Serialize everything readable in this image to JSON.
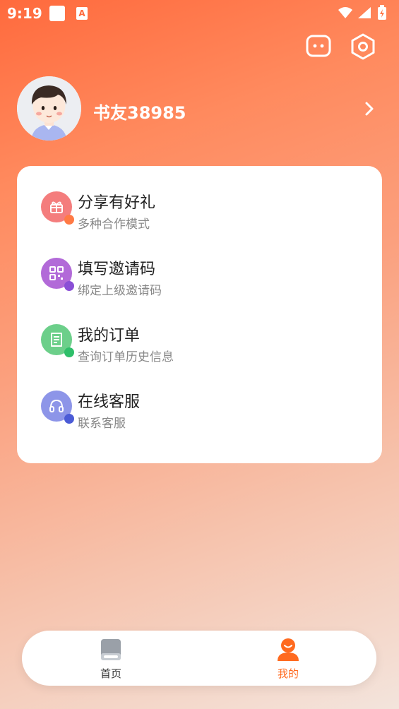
{
  "status_bar": {
    "time": "9:19",
    "a_badge": "A"
  },
  "profile": {
    "username": "书友38985"
  },
  "menu": [
    {
      "title": "分享有好礼",
      "subtitle": "多种合作模式",
      "icon": "gift-icon",
      "color": "#f47d7d",
      "accent": "#ff7a45"
    },
    {
      "title": "填写邀请码",
      "subtitle": "绑定上级邀请码",
      "icon": "qr-code-icon",
      "color": "#b26ad8",
      "accent": "#8a4fd6"
    },
    {
      "title": "我的订单",
      "subtitle": "查询订单历史信息",
      "icon": "receipt-icon",
      "color": "#6ccf8a",
      "accent": "#2fbf6a"
    },
    {
      "title": "在线客服",
      "subtitle": "联系客服",
      "icon": "headset-icon",
      "color": "#8d95e8",
      "accent": "#4b5bd6"
    }
  ],
  "bottom_nav": {
    "home_label": "首页",
    "mine_label": "我的",
    "active": "mine",
    "active_color": "#ff6a1f"
  }
}
